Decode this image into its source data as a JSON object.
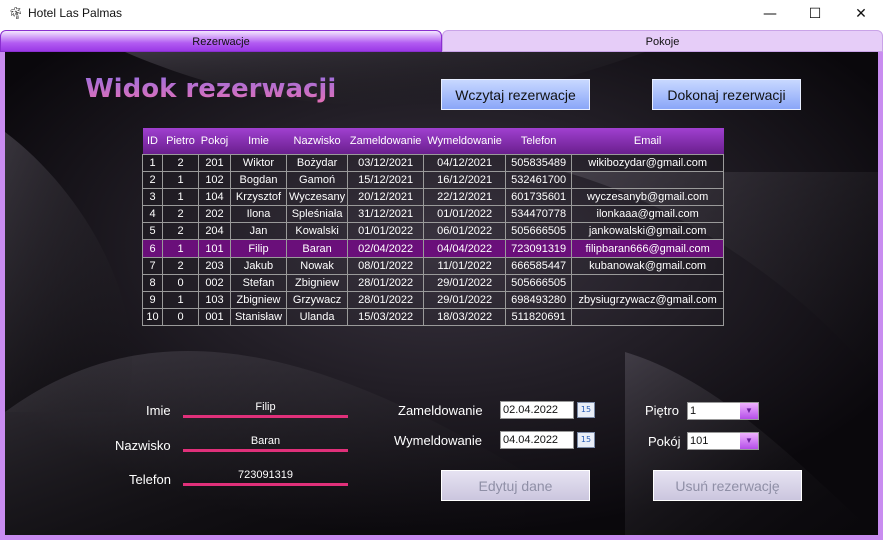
{
  "window": {
    "icon": "palm-tree-icon",
    "title": "Hotel Las Palmas",
    "controls": {
      "minimize": "—",
      "maximize": "☐",
      "close": "✕"
    }
  },
  "tabs": [
    {
      "label": "Rezerwacje",
      "active": true
    },
    {
      "label": "Pokoje",
      "active": false
    }
  ],
  "heading": "Widok rezerwacji",
  "buttons": {
    "load": "Wczytaj rezerwacje",
    "make": "Dokonaj rezerwacji",
    "edit": "Edytuj dane",
    "delete": "Usuń rezerwację"
  },
  "table": {
    "columns": [
      "ID",
      "Pietro",
      "Pokoj",
      "Imie",
      "Nazwisko",
      "Zameldowanie",
      "Wymeldowanie",
      "Telefon",
      "Email"
    ],
    "rows": [
      [
        "1",
        "2",
        "201",
        "Wiktor",
        "Bożydar",
        "03/12/2021",
        "04/12/2021",
        "505835489",
        "wikibozydar@gmail.com"
      ],
      [
        "2",
        "1",
        "102",
        "Bogdan",
        "Gamoń",
        "15/12/2021",
        "16/12/2021",
        "532461700",
        ""
      ],
      [
        "3",
        "1",
        "104",
        "Krzysztof",
        "Wyczesany",
        "20/12/2021",
        "22/12/2021",
        "601735601",
        "wyczesanyb@gmail.com"
      ],
      [
        "4",
        "2",
        "202",
        "Ilona",
        "Spleśniała",
        "31/12/2021",
        "01/01/2022",
        "534470778",
        "ilonkaaa@gmail.com"
      ],
      [
        "5",
        "2",
        "204",
        "Jan",
        "Kowalski",
        "01/01/2022",
        "06/01/2022",
        "505666505",
        "jankowalski@gmail.com"
      ],
      [
        "6",
        "1",
        "101",
        "Filip",
        "Baran",
        "02/04/2022",
        "04/04/2022",
        "723091319",
        "filipbaran666@gmail.com"
      ],
      [
        "7",
        "2",
        "203",
        "Jakub",
        "Nowak",
        "08/01/2022",
        "11/01/2022",
        "666585447",
        "kubanowak@gmail.com"
      ],
      [
        "8",
        "0",
        "002",
        "Stefan",
        "Zbigniew",
        "28/01/2022",
        "29/01/2022",
        "505666505",
        ""
      ],
      [
        "9",
        "1",
        "103",
        "Zbigniew",
        "Grzywacz",
        "28/01/2022",
        "29/01/2022",
        "698493280",
        "zbysiugrzywacz@gmail.com"
      ],
      [
        "10",
        "0",
        "001",
        "Stanisław",
        "Ulanda",
        "15/03/2022",
        "18/03/2022",
        "511820691",
        ""
      ]
    ],
    "selected_row_index": 5
  },
  "form": {
    "imie": {
      "label": "Imie",
      "value": "Filip"
    },
    "nazwisko": {
      "label": "Nazwisko",
      "value": "Baran"
    },
    "telefon": {
      "label": "Telefon",
      "value": "723091319"
    },
    "zameldowanie": {
      "label": "Zameldowanie",
      "value": "02.04.2022"
    },
    "wymeldowanie": {
      "label": "Wymeldowanie",
      "value": "04.04.2022"
    },
    "calendar_icon_text": "15",
    "pietro": {
      "label": "Piętro",
      "value": "1"
    },
    "pokoj": {
      "label": "Pokój",
      "value": "101"
    }
  },
  "colors": {
    "accent_purple": "#9b3ae6",
    "field_underline": "#e0307a",
    "selected_row": "#6a0f7a",
    "button_blue": "#8aa6f8"
  }
}
